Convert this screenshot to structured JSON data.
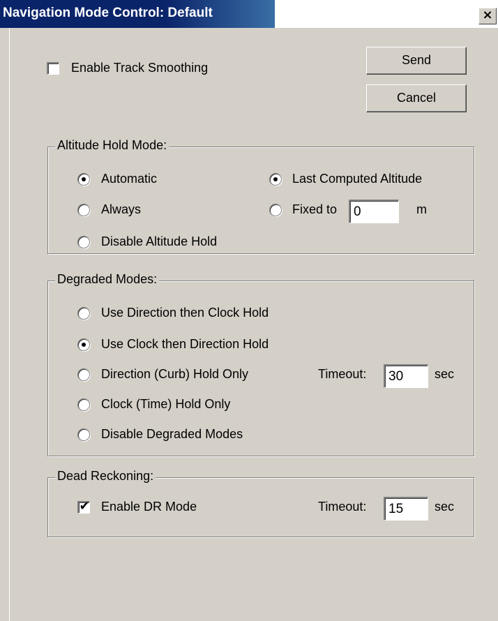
{
  "window": {
    "title": "Navigation Mode Control: Default",
    "close_glyph": "×"
  },
  "track_smoothing": {
    "label": "Enable Track Smoothing",
    "checked": false
  },
  "buttons": {
    "send": "Send",
    "cancel": "Cancel"
  },
  "altitude": {
    "group_label": "Altitude Hold Mode:",
    "automatic": "Automatic",
    "always": "Always",
    "disable": "Disable Altitude Hold",
    "last_computed": "Last Computed Altitude",
    "fixed_to": "Fixed to",
    "fixed_value": "0",
    "fixed_unit": "m",
    "selected_mode": "Automatic",
    "selected_source": "Last Computed Altitude"
  },
  "degraded": {
    "group_label": "Degraded Modes:",
    "options": [
      "Use Direction then Clock Hold",
      "Use Clock then Direction Hold",
      "Direction (Curb) Hold Only",
      "Clock (Time) Hold Only",
      "Disable Degraded Modes"
    ],
    "selected": "Use Clock then Direction Hold",
    "timeout_label": "Timeout:",
    "timeout_value": "30",
    "timeout_unit": "sec"
  },
  "dead_reckoning": {
    "group_label": "Dead Reckoning:",
    "enable_label": "Enable DR Mode",
    "checked": true,
    "check_glyph": "✔",
    "timeout_label": "Timeout:",
    "timeout_value": "15",
    "timeout_unit": "sec"
  }
}
